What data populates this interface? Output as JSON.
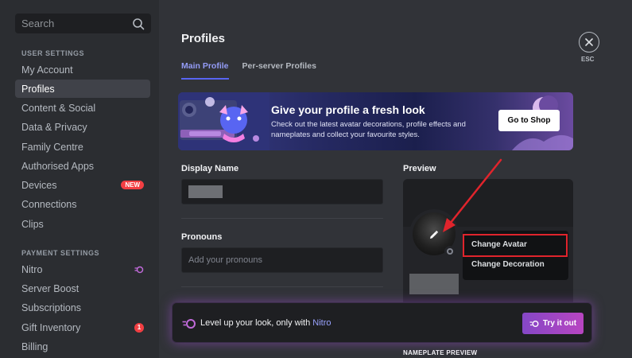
{
  "sidebar": {
    "search_placeholder": "Search",
    "user_settings_header": "USER SETTINGS",
    "user_items": [
      {
        "label": "My Account"
      },
      {
        "label": "Profiles"
      },
      {
        "label": "Content & Social"
      },
      {
        "label": "Data & Privacy"
      },
      {
        "label": "Family Centre"
      },
      {
        "label": "Authorised Apps"
      },
      {
        "label": "Devices",
        "badge": "NEW"
      },
      {
        "label": "Connections"
      },
      {
        "label": "Clips"
      }
    ],
    "payment_settings_header": "PAYMENT SETTINGS",
    "payment_items": [
      {
        "label": "Nitro",
        "icon": "nitro-icon"
      },
      {
        "label": "Server Boost"
      },
      {
        "label": "Subscriptions"
      },
      {
        "label": "Gift Inventory",
        "badge": "1"
      },
      {
        "label": "Billing"
      }
    ],
    "active_item": "Profiles"
  },
  "header": {
    "title": "Profiles",
    "tabs": [
      {
        "label": "Main Profile",
        "active": true
      },
      {
        "label": "Per-server Profiles",
        "active": false
      }
    ],
    "close_label": "ESC"
  },
  "banner": {
    "title": "Give your profile a fresh look",
    "description": "Check out the latest avatar decorations, profile effects and nameplates and collect your favourite styles.",
    "button": "Go to Shop"
  },
  "form": {
    "display_name_label": "Display Name",
    "pronouns_label": "Pronouns",
    "pronouns_placeholder": "Add your pronouns"
  },
  "preview": {
    "label": "Preview",
    "nameplate_label": "NAMEPLATE PREVIEW"
  },
  "context_menu": {
    "items": [
      "Change Avatar",
      "Change Decoration"
    ],
    "highlighted": "Change Avatar"
  },
  "upsell": {
    "text": "Level up your look, only with ",
    "link": "Nitro",
    "button": "Try it out"
  },
  "colors": {
    "accent": "#5865f2",
    "highlight_box": "#e0242c",
    "nitro_gradient_start": "#8547c6",
    "nitro_gradient_end": "#b845c1",
    "badge_red": "#f23f43"
  }
}
